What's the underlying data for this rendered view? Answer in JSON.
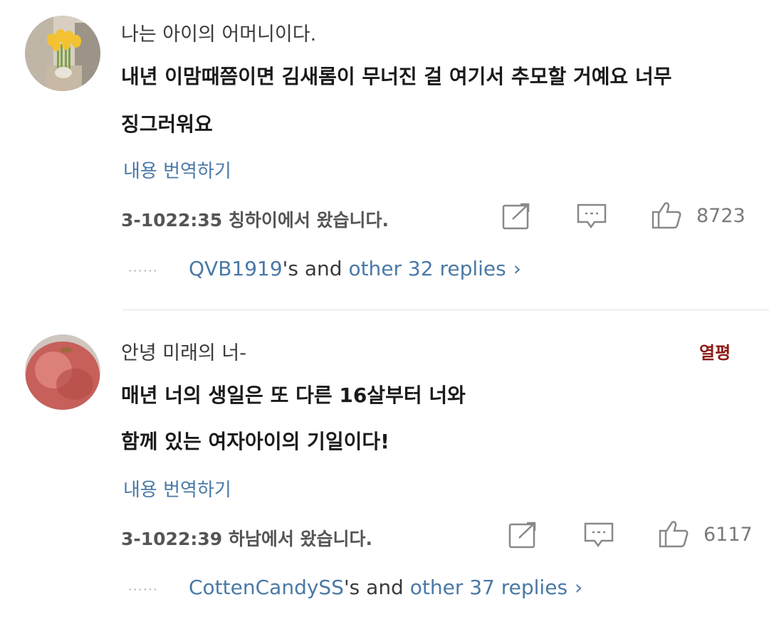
{
  "comments": [
    {
      "username": "나는 아이의 어머니이다.",
      "body_lines": [
        "내년 이맘때쯤이면 김새롬이 무너진 걸 여기서 추모할 거예요 너무",
        "징그러워요"
      ],
      "translate_label": "내용 번역하기",
      "meta": "3-1022:35 칭하이에서 왔습니다.",
      "like_count": "8723",
      "reply_user": "QVB1919",
      "reply_mid": "'s and ",
      "reply_other": "other 32 replies",
      "avatar_icon": "tulip-bouquet-avatar"
    },
    {
      "username": "안녕 미래의 너-",
      "badge": "열평",
      "body_lines": [
        "매년 너의 생일은 또 다른 16살부터 너와",
        "함께 있는 여자아이의 기일이다!"
      ],
      "translate_label": "내용 번역하기",
      "meta": "3-1022:39 하남에서 왔습니다.",
      "like_count": "6117",
      "reply_user": "CottenCandySS",
      "reply_mid": "'s and ",
      "reply_other": "other 37 replies",
      "avatar_icon": "apple-avatar"
    }
  ],
  "dots": "······",
  "chevron": "›",
  "colors": {
    "link": "#4a79a6",
    "badge": "#8c1a16",
    "text": "#1a1a1a"
  }
}
